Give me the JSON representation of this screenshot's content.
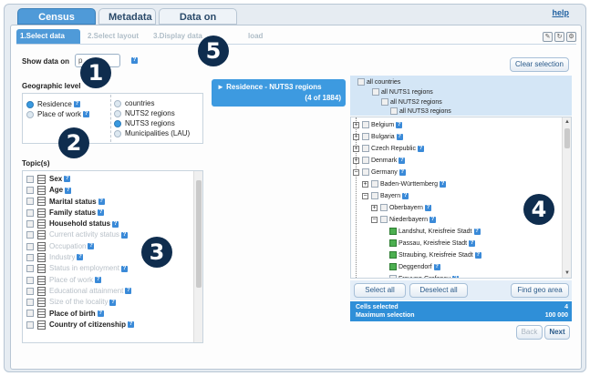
{
  "tabs": [
    {
      "label": "Census data"
    },
    {
      "label": "Metadata"
    },
    {
      "label": "Data on quality"
    }
  ],
  "help_link": "help",
  "steps": [
    {
      "label": "1.Select data"
    },
    {
      "label": "2.Select layout"
    },
    {
      "label": "3.Display data"
    },
    {
      "label": "load"
    }
  ],
  "show_data_on": {
    "label": "Show data on",
    "dropdown_value": "p"
  },
  "clear_selection": "Clear selection",
  "geo_level": {
    "title": "Geographic level",
    "left": [
      {
        "label": "Residence",
        "selected": true
      },
      {
        "label": "Place of work",
        "selected": false
      }
    ],
    "right": [
      {
        "label": "countries",
        "selected": false
      },
      {
        "label": "NUTS2 regions",
        "selected": false
      },
      {
        "label": "NUTS3 regions",
        "selected": true
      },
      {
        "label": "Municipalities (LAU)",
        "selected": false
      }
    ]
  },
  "topics": {
    "title": "Topic(s)",
    "items": [
      {
        "label": "Sex",
        "state": "active"
      },
      {
        "label": "Age",
        "state": "active"
      },
      {
        "label": "Marital status",
        "state": "active"
      },
      {
        "label": "Family status",
        "state": "active"
      },
      {
        "label": "Household status",
        "state": "active"
      },
      {
        "label": "Current activity status",
        "state": "dim"
      },
      {
        "label": "Occupation",
        "state": "dim"
      },
      {
        "label": "Industry",
        "state": "dim"
      },
      {
        "label": "Status in employment",
        "state": "dim"
      },
      {
        "label": "Place of work",
        "state": "dim"
      },
      {
        "label": "Educational attainment",
        "state": "dim"
      },
      {
        "label": "Size of the locality",
        "state": "dim"
      },
      {
        "label": "Place of birth",
        "state": "active"
      },
      {
        "label": "Country of citizenship",
        "state": "active"
      }
    ]
  },
  "selection_box": {
    "title": "► Residence - NUTS3 regions",
    "count": "(4 of 1884)"
  },
  "geo_tree": {
    "header": [
      {
        "label": "all countries",
        "level": 0
      },
      {
        "label": "all NUTS1 regions",
        "level": 1
      },
      {
        "label": "all NUTS2 regions",
        "level": 2
      },
      {
        "label": "all NUTS3 regions",
        "level": 3
      }
    ],
    "rows": [
      {
        "label": "Belgium",
        "level": 0,
        "expander": "+",
        "checked": false
      },
      {
        "label": "Bulgaria",
        "level": 0,
        "expander": "+",
        "checked": false
      },
      {
        "label": "Czech Republic",
        "level": 0,
        "expander": "+",
        "checked": false
      },
      {
        "label": "Denmark",
        "level": 0,
        "expander": "+",
        "checked": false
      },
      {
        "label": "Germany",
        "level": 0,
        "expander": "−",
        "checked": false
      },
      {
        "label": "Baden-Württemberg",
        "level": 1,
        "expander": "+",
        "checked": false
      },
      {
        "label": "Bayern",
        "level": 1,
        "expander": "−",
        "checked": false
      },
      {
        "label": "Oberbayern",
        "level": 2,
        "expander": "+",
        "checked": false
      },
      {
        "label": "Niederbayern",
        "level": 2,
        "expander": "−",
        "checked": false
      },
      {
        "label": "Landshut, Kreisfreie Stadt",
        "level": 3,
        "expander": "",
        "checked": true
      },
      {
        "label": "Passau, Kreisfreie Stadt",
        "level": 3,
        "expander": "",
        "checked": true
      },
      {
        "label": "Straubing, Kreisfreie Stadt",
        "level": 3,
        "expander": "",
        "checked": true
      },
      {
        "label": "Deggendorf",
        "level": 3,
        "expander": "",
        "checked": true
      },
      {
        "label": "Freyung-Grafenau",
        "level": 3,
        "expander": "",
        "checked": false
      }
    ]
  },
  "buttons": {
    "select_all": "Select all",
    "deselect_all": "Deselect all",
    "find_geo_area": "Find geo area",
    "back": "Back",
    "next": "Next"
  },
  "cells_info": {
    "cells_selected_label": "Cells selected",
    "cells_selected_value": "4",
    "max_selection_label": "Maximum selection",
    "max_selection_value": "100 000"
  },
  "callouts": [
    "1",
    "2",
    "3",
    "4",
    "5"
  ]
}
